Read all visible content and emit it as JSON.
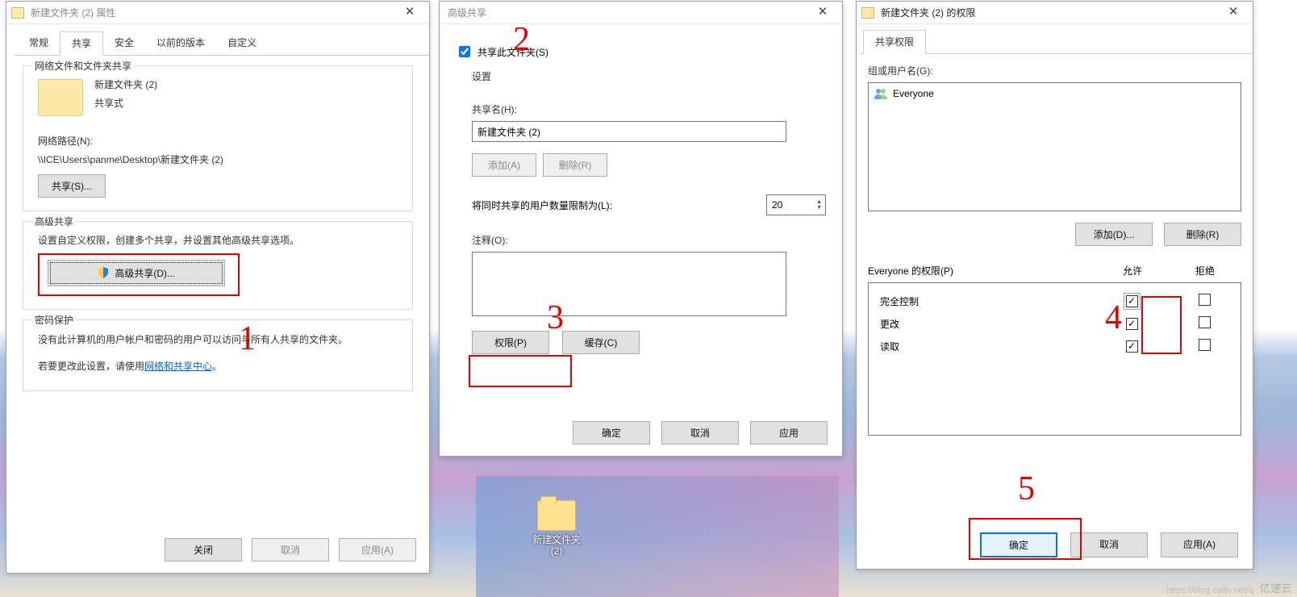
{
  "d1": {
    "title": "新建文件夹 (2) 属性",
    "tabs": [
      "常规",
      "共享",
      "安全",
      "以前的版本",
      "自定义"
    ],
    "sec_net": {
      "legend": "网络文件和文件夹共享",
      "folder_name": "新建文件夹 (2)",
      "shared_label": "共享式",
      "netpath_label": "网络路径(N):",
      "netpath_value": "\\\\ICE\\Users\\panme\\Desktop\\新建文件夹 (2)",
      "share_btn": "共享(S)..."
    },
    "sec_adv": {
      "legend": "高级共享",
      "desc": "设置自定义权限，创建多个共享，并设置其他高级共享选项。",
      "btn": "高级共享(D)..."
    },
    "sec_pwd": {
      "legend": "密码保护",
      "line1": "没有此计算机的用户帐户和密码的用户可以访问与所有人共享的文件夹。",
      "line2_prefix": "若要更改此设置，请使用",
      "line2_link": "网络和共享中心",
      "line2_suffix": "。"
    },
    "bottom": {
      "close": "关闭",
      "cancel": "取消",
      "apply": "应用(A)"
    }
  },
  "d2": {
    "title": "高级共享",
    "share_chk": "共享此文件夹(S)",
    "settings_legend": "设置",
    "sharename_label": "共享名(H):",
    "sharename_value": "新建文件夹 (2)",
    "add_btn": "添加(A)",
    "remove_btn": "删除(R)",
    "limit_label": "将同时共享的用户数量限制为(L):",
    "limit_value": "20",
    "comment_label": "注释(O):",
    "perm_btn": "权限(P)",
    "cache_btn": "缓存(C)",
    "bottom": {
      "ok": "确定",
      "cancel": "取消",
      "apply": "应用"
    }
  },
  "d3": {
    "title": "新建文件夹 (2) 的权限",
    "tab": "共享权限",
    "group_label": "组或用户名(G):",
    "user": "Everyone",
    "add_btn": "添加(D)...",
    "remove_btn": "删除(R)",
    "perm_header": "Everyone 的权限(P)",
    "allow": "允许",
    "deny": "拒绝",
    "rows": [
      "完全控制",
      "更改",
      "读取"
    ],
    "bottom": {
      "ok": "确定",
      "cancel": "取消",
      "apply": "应用(A)"
    }
  },
  "desktop": {
    "folder_label": "新建文件夹\n(2)"
  },
  "watermark": "亿速云",
  "annotations": {
    "n1": "1",
    "n2": "2",
    "n3": "3",
    "n4": "4",
    "n5": "5"
  }
}
